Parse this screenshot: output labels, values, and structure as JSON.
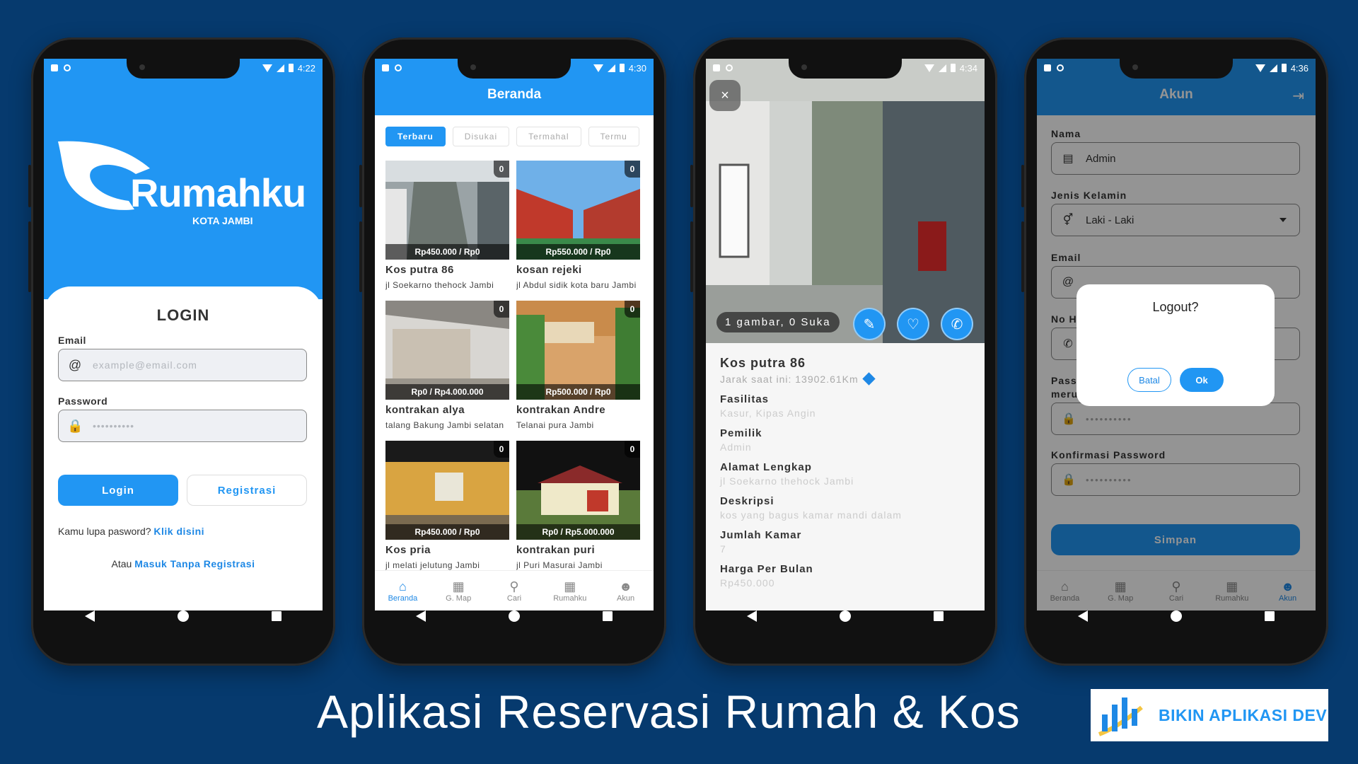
{
  "status": {
    "phone1_time": "4:22",
    "phone2_time": "4:30",
    "phone3_time": "4:34",
    "phone4_time": "4:36"
  },
  "login": {
    "logo_text": "Rumahku",
    "logo_sub": "KOTA JAMBI",
    "title": "LOGIN",
    "email_label": "Email",
    "email_placeholder": "example@email.com",
    "password_label": "Password",
    "password_placeholder": "••••••••••",
    "login_button": "Login",
    "register_button": "Registrasi",
    "forgot_prefix": "Kamu lupa pasword?",
    "forgot_link": "Klik disini",
    "noreg_prefix": "Atau",
    "noreg_link": "Masuk Tanpa Registrasi"
  },
  "beranda": {
    "title": "Beranda",
    "chips": [
      "Terbaru",
      "Disukai",
      "Termahal",
      "Termu"
    ],
    "listings": [
      {
        "name": "Kos putra 86",
        "address": "jl Soekarno thehock Jambi",
        "price": "Rp450.000 / Rp0",
        "likes": "0"
      },
      {
        "name": "kosan rejeki",
        "address": "jl Abdul sidik kota baru Jambi",
        "price": "Rp550.000 / Rp0",
        "likes": "0"
      },
      {
        "name": "kontrakan alya",
        "address": "talang Bakung Jambi selatan",
        "price": "Rp0 / Rp4.000.000",
        "likes": "0"
      },
      {
        "name": "kontrakan Andre",
        "address": "Telanai pura Jambi",
        "price": "Rp500.000 / Rp0",
        "likes": "0"
      },
      {
        "name": "Kos pria",
        "address": "jl melati jelutung Jambi",
        "price": "Rp450.000 / Rp0",
        "likes": "0"
      },
      {
        "name": "kontrakan puri",
        "address": "jl Puri Masurai Jambi",
        "price": "Rp0 / Rp5.000.000",
        "likes": "0"
      }
    ]
  },
  "bottom_nav": {
    "items": [
      "Beranda",
      "G. Map",
      "Cari",
      "Rumahku",
      "Akun"
    ]
  },
  "detail": {
    "close_symbol": "×",
    "image_count": "1 gambar, 0 Suka",
    "title": "Kos putra 86",
    "distance": "Jarak saat ini: 13902.61Km",
    "fasilitas_label": "Fasilitas",
    "fasilitas": "Kasur, Kipas Angin",
    "pemilik_label": "Pemilik",
    "pemilik": "Admin",
    "alamat_label": "Alamat Lengkap",
    "alamat": "jl Soekarno thehock Jambi",
    "deskripsi_label": "Deskripsi",
    "deskripsi": "kos yang bagus kamar mandi dalam",
    "jumlah_label": "Jumlah Kamar",
    "jumlah": "7",
    "harga_label": "Harga Per Bulan",
    "harga": "Rp450.000"
  },
  "akun": {
    "title": "Akun",
    "nama_label": "Nama",
    "nama": "Admin",
    "jk_label": "Jenis Kelamin",
    "jk": "Laki - Laki",
    "email_label": "Email",
    "nohp_label": "No H",
    "pass_label1": "Pass",
    "pass_label2": "meru",
    "password_mask": "••••••••••",
    "konfirmasi_label": "Konfirmasi Password",
    "simpan": "Simpan",
    "dialog_title": "Logout?",
    "dialog_cancel": "Batal",
    "dialog_ok": "Ok"
  },
  "banner": {
    "headline": "Aplikasi Reservasi Rumah & Kos",
    "brand": "BIKIN APLIKASI DEV"
  },
  "colors": {
    "background": "#063a6e",
    "primary": "#2196f3"
  }
}
